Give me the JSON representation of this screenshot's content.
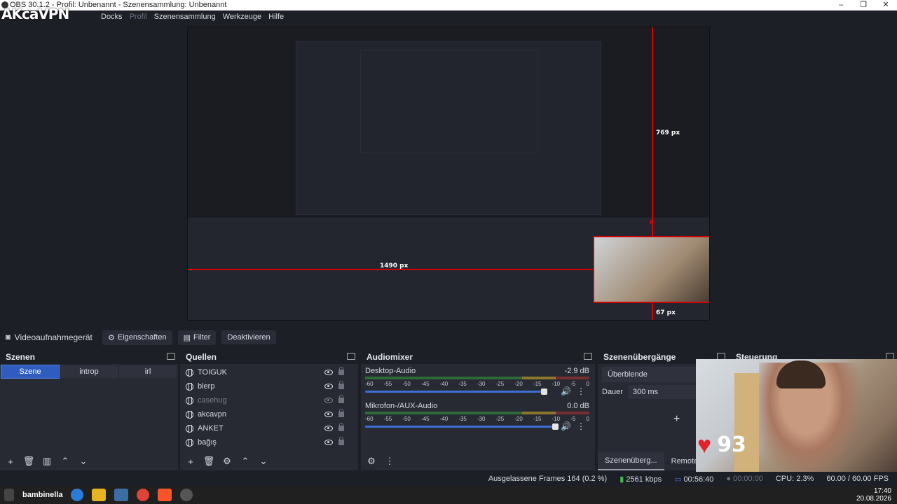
{
  "window": {
    "title": "OBS 30.1.2 - Profil: Unbenannt - Szenensammlung: Unbenannt",
    "controls": [
      "–",
      "❐",
      "✕"
    ]
  },
  "branding": {
    "logo_text": "AKcaVPN"
  },
  "menu": {
    "items": [
      "Docks",
      "Profil",
      "Szenensammlung",
      "Werkzeuge",
      "Hilfe"
    ]
  },
  "preview": {
    "height_label": "769 px",
    "width_label": "1490 px",
    "bottom_label": "67 px"
  },
  "source_toolbar": {
    "device_label": "Videoaufnahmegerät",
    "properties_label": "Eigenschaften",
    "filter_label": "Filter",
    "deactivate_label": "Deaktivieren"
  },
  "scenes": {
    "title": "Szenen",
    "items": [
      "Szene",
      "introp",
      "irl"
    ]
  },
  "sources": {
    "title": "Quellen",
    "items": [
      {
        "name": "TOIGUK",
        "visible": true
      },
      {
        "name": "blerp",
        "visible": true
      },
      {
        "name": "casehug",
        "visible": false
      },
      {
        "name": "akcavpn",
        "visible": true
      },
      {
        "name": "ANKET",
        "visible": true
      },
      {
        "name": "bağış",
        "visible": true
      }
    ]
  },
  "mixer": {
    "title": "Audiomixer",
    "channels": [
      {
        "name": "Desktop-Audio",
        "db": "-2.9 dB",
        "level": 0.92
      },
      {
        "name": "Mikrofon-/AUX-Audio",
        "db": "0.0 dB",
        "level": 1.0
      }
    ],
    "ticks": [
      "-60",
      "-55",
      "-50",
      "-45",
      "-40",
      "-35",
      "-30",
      "-25",
      "-20",
      "-15",
      "-10",
      "-5",
      "0"
    ]
  },
  "transitions": {
    "title": "Szenenübergänge",
    "selected": "Überblende",
    "duration_label": "Dauer",
    "duration_value": "300 ms",
    "tabs": [
      "Szenenüberg...",
      "Remote Cont"
    ]
  },
  "controls_dock": {
    "title": "Steuerung"
  },
  "overlay": {
    "heart_rate": "93"
  },
  "status": {
    "dropped": "Ausgelassene Frames 164 (0.2 %)",
    "bitrate": "2561 kbps",
    "live_time": "00:56:40",
    "rec_time": "00:00:00",
    "cpu": "CPU: 2.3%",
    "fps": "60.00 / 60.00 FPS"
  },
  "taskbar": {
    "user": "bambinella",
    "time": "17:40",
    "date": "20.08.2026"
  },
  "colors": {
    "accent": "#2f5dbf",
    "guide": "#d40000",
    "heart": "#e0222d"
  }
}
